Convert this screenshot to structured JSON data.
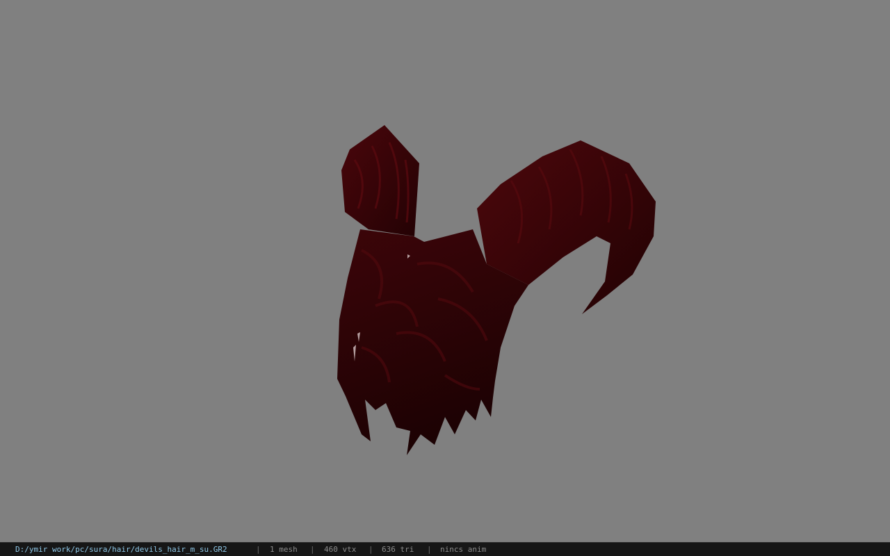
{
  "window": {
    "background_color": "#808080"
  },
  "viewport": {
    "model": {
      "name": "devils-hair-model",
      "primary_color": "#3a0508",
      "shadow_color": "#1e0204"
    }
  },
  "statusbar": {
    "file_path": "D:/ymir work/pc/sura/hair/devils_hair_m_su.GR2",
    "separator": "|",
    "mesh_count": "1 mesh",
    "vertex_count": "460 vtx",
    "triangle_count": "636 tri",
    "anim_status": "nincs anim",
    "path_color": "#8fc8e8"
  }
}
